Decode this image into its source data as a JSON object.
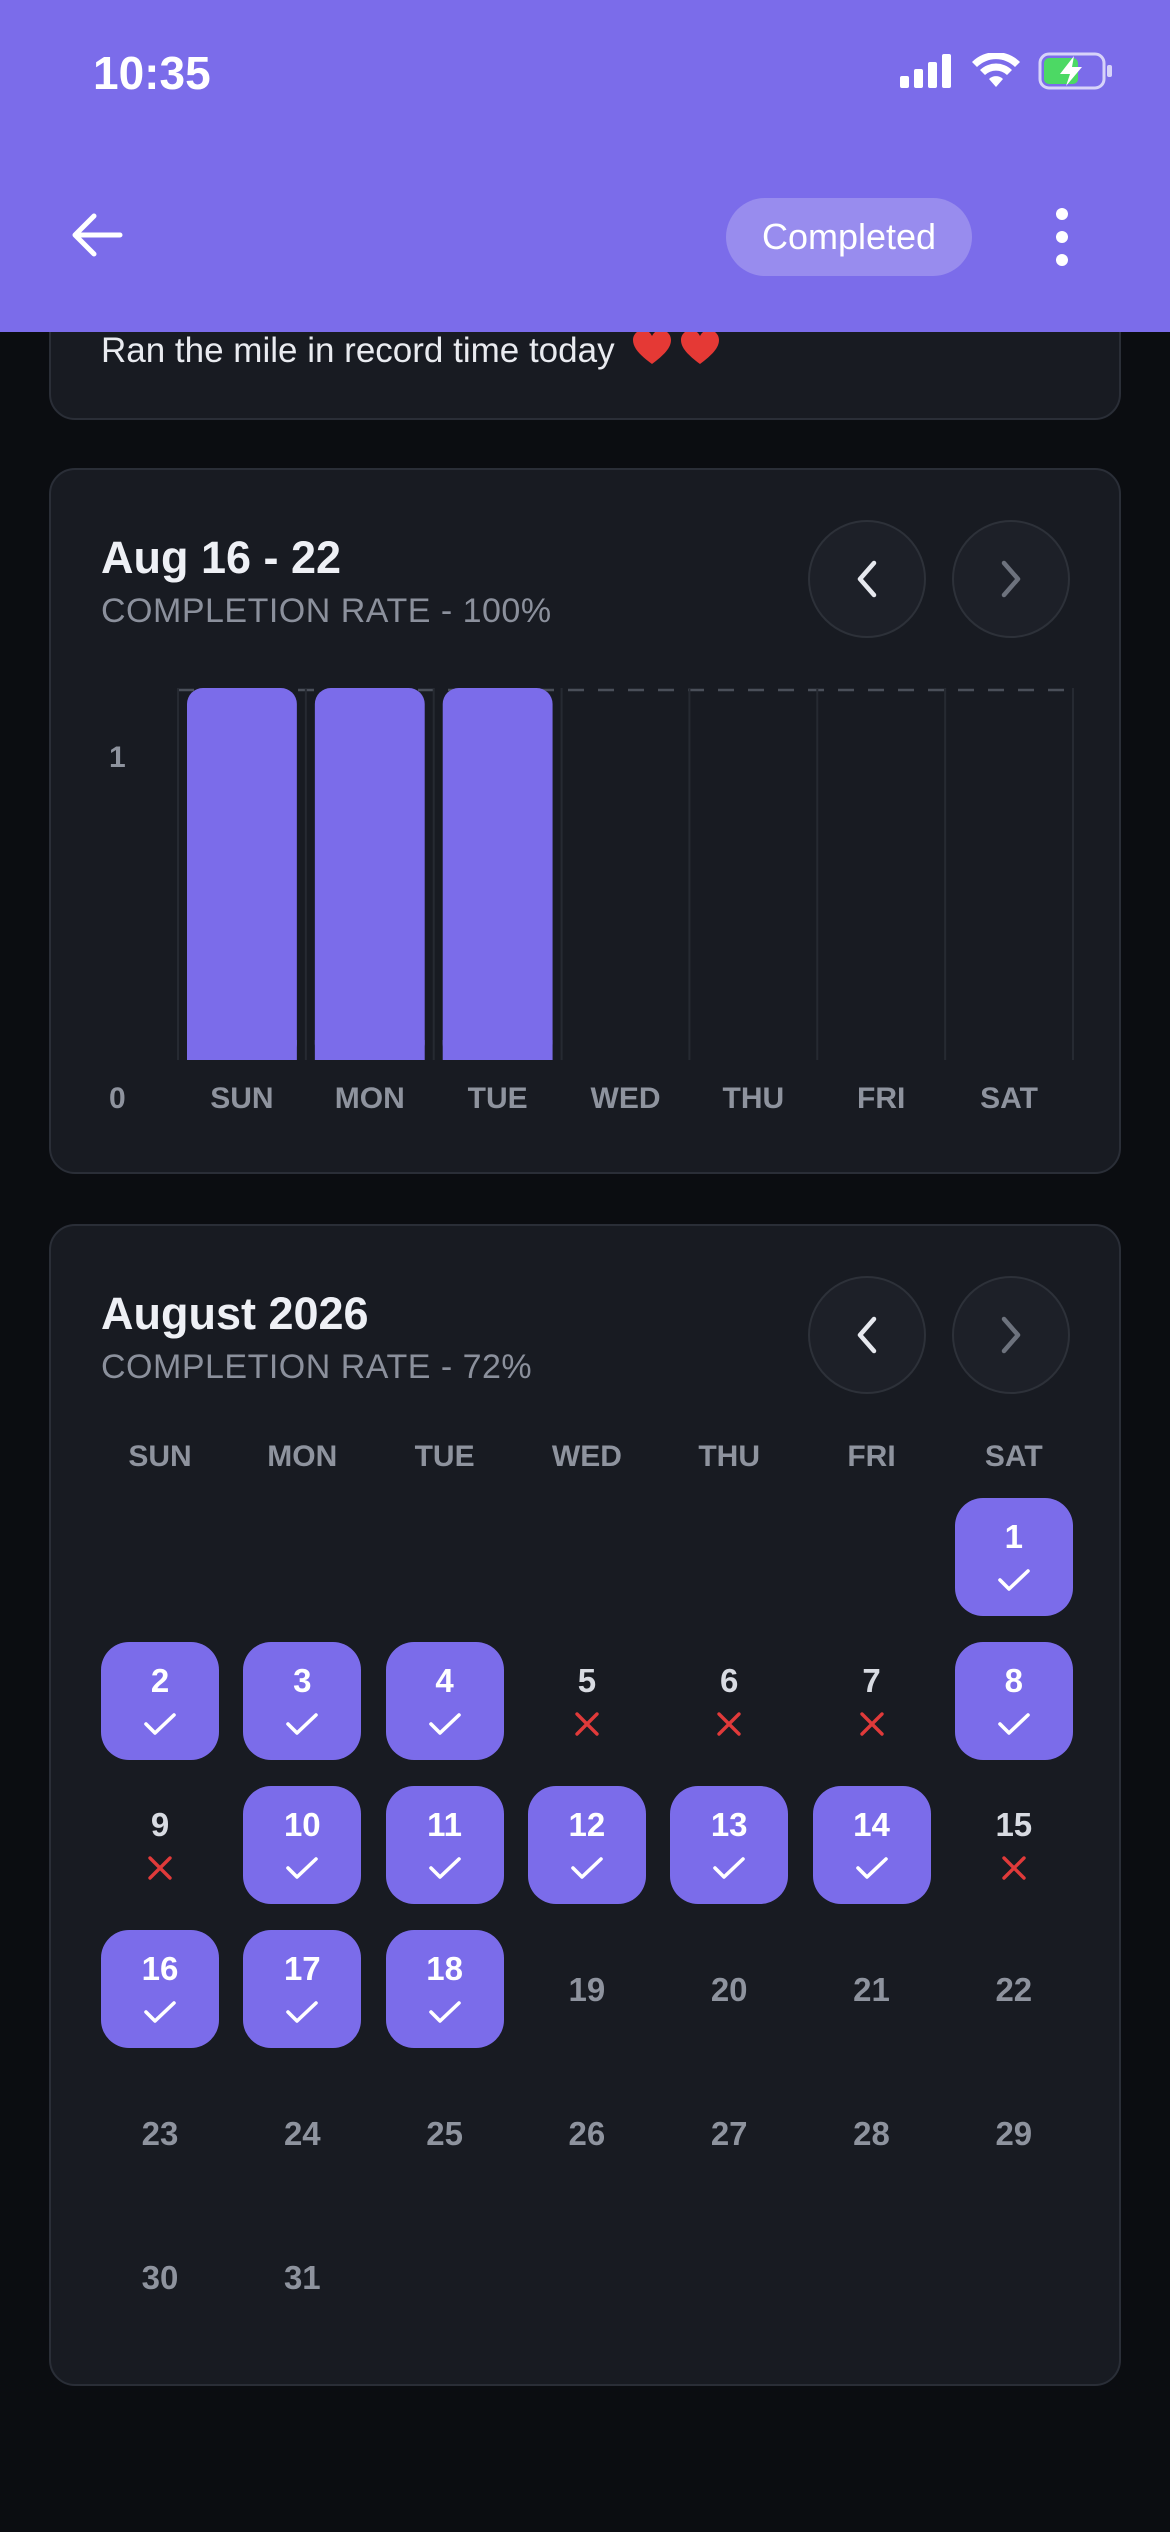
{
  "status_bar": {
    "time": "10:35"
  },
  "header": {
    "status_label": "Completed"
  },
  "note": {
    "text": "Ran the mile in record time today"
  },
  "week": {
    "title": "Aug 16 - 22",
    "completion": "COMPLETION RATE - 100%",
    "chart_data": {
      "type": "bar",
      "categories": [
        "SUN",
        "MON",
        "TUE",
        "WED",
        "THU",
        "FRI",
        "SAT"
      ],
      "values": [
        1,
        1,
        1,
        0,
        0,
        0,
        0
      ],
      "ylim": [
        0,
        1
      ],
      "yticks": [
        "0",
        "1"
      ],
      "bar_color": "#7b6cea"
    }
  },
  "month": {
    "title": "August 2026",
    "completion": "COMPLETION RATE - 72%",
    "weekdays": [
      "SUN",
      "MON",
      "TUE",
      "WED",
      "THU",
      "FRI",
      "SAT"
    ],
    "start_offset": 6,
    "days": [
      {
        "d": "1",
        "s": "done"
      },
      {
        "d": "2",
        "s": "done"
      },
      {
        "d": "3",
        "s": "done"
      },
      {
        "d": "4",
        "s": "done"
      },
      {
        "d": "5",
        "s": "miss"
      },
      {
        "d": "6",
        "s": "miss"
      },
      {
        "d": "7",
        "s": "miss"
      },
      {
        "d": "8",
        "s": "done"
      },
      {
        "d": "9",
        "s": "miss"
      },
      {
        "d": "10",
        "s": "done"
      },
      {
        "d": "11",
        "s": "done"
      },
      {
        "d": "12",
        "s": "done"
      },
      {
        "d": "13",
        "s": "done"
      },
      {
        "d": "14",
        "s": "done"
      },
      {
        "d": "15",
        "s": "miss"
      },
      {
        "d": "16",
        "s": "done"
      },
      {
        "d": "17",
        "s": "done"
      },
      {
        "d": "18",
        "s": "done"
      },
      {
        "d": "19",
        "s": "none"
      },
      {
        "d": "20",
        "s": "none"
      },
      {
        "d": "21",
        "s": "none"
      },
      {
        "d": "22",
        "s": "none"
      },
      {
        "d": "23",
        "s": "none"
      },
      {
        "d": "24",
        "s": "none"
      },
      {
        "d": "25",
        "s": "none"
      },
      {
        "d": "26",
        "s": "none"
      },
      {
        "d": "27",
        "s": "none"
      },
      {
        "d": "28",
        "s": "none"
      },
      {
        "d": "29",
        "s": "none"
      },
      {
        "d": "30",
        "s": "none"
      },
      {
        "d": "31",
        "s": "none"
      }
    ]
  },
  "colors": {
    "accent": "#7b6cea",
    "card": "#181b22",
    "background": "#0b0d11",
    "miss": "#e03a3a"
  }
}
